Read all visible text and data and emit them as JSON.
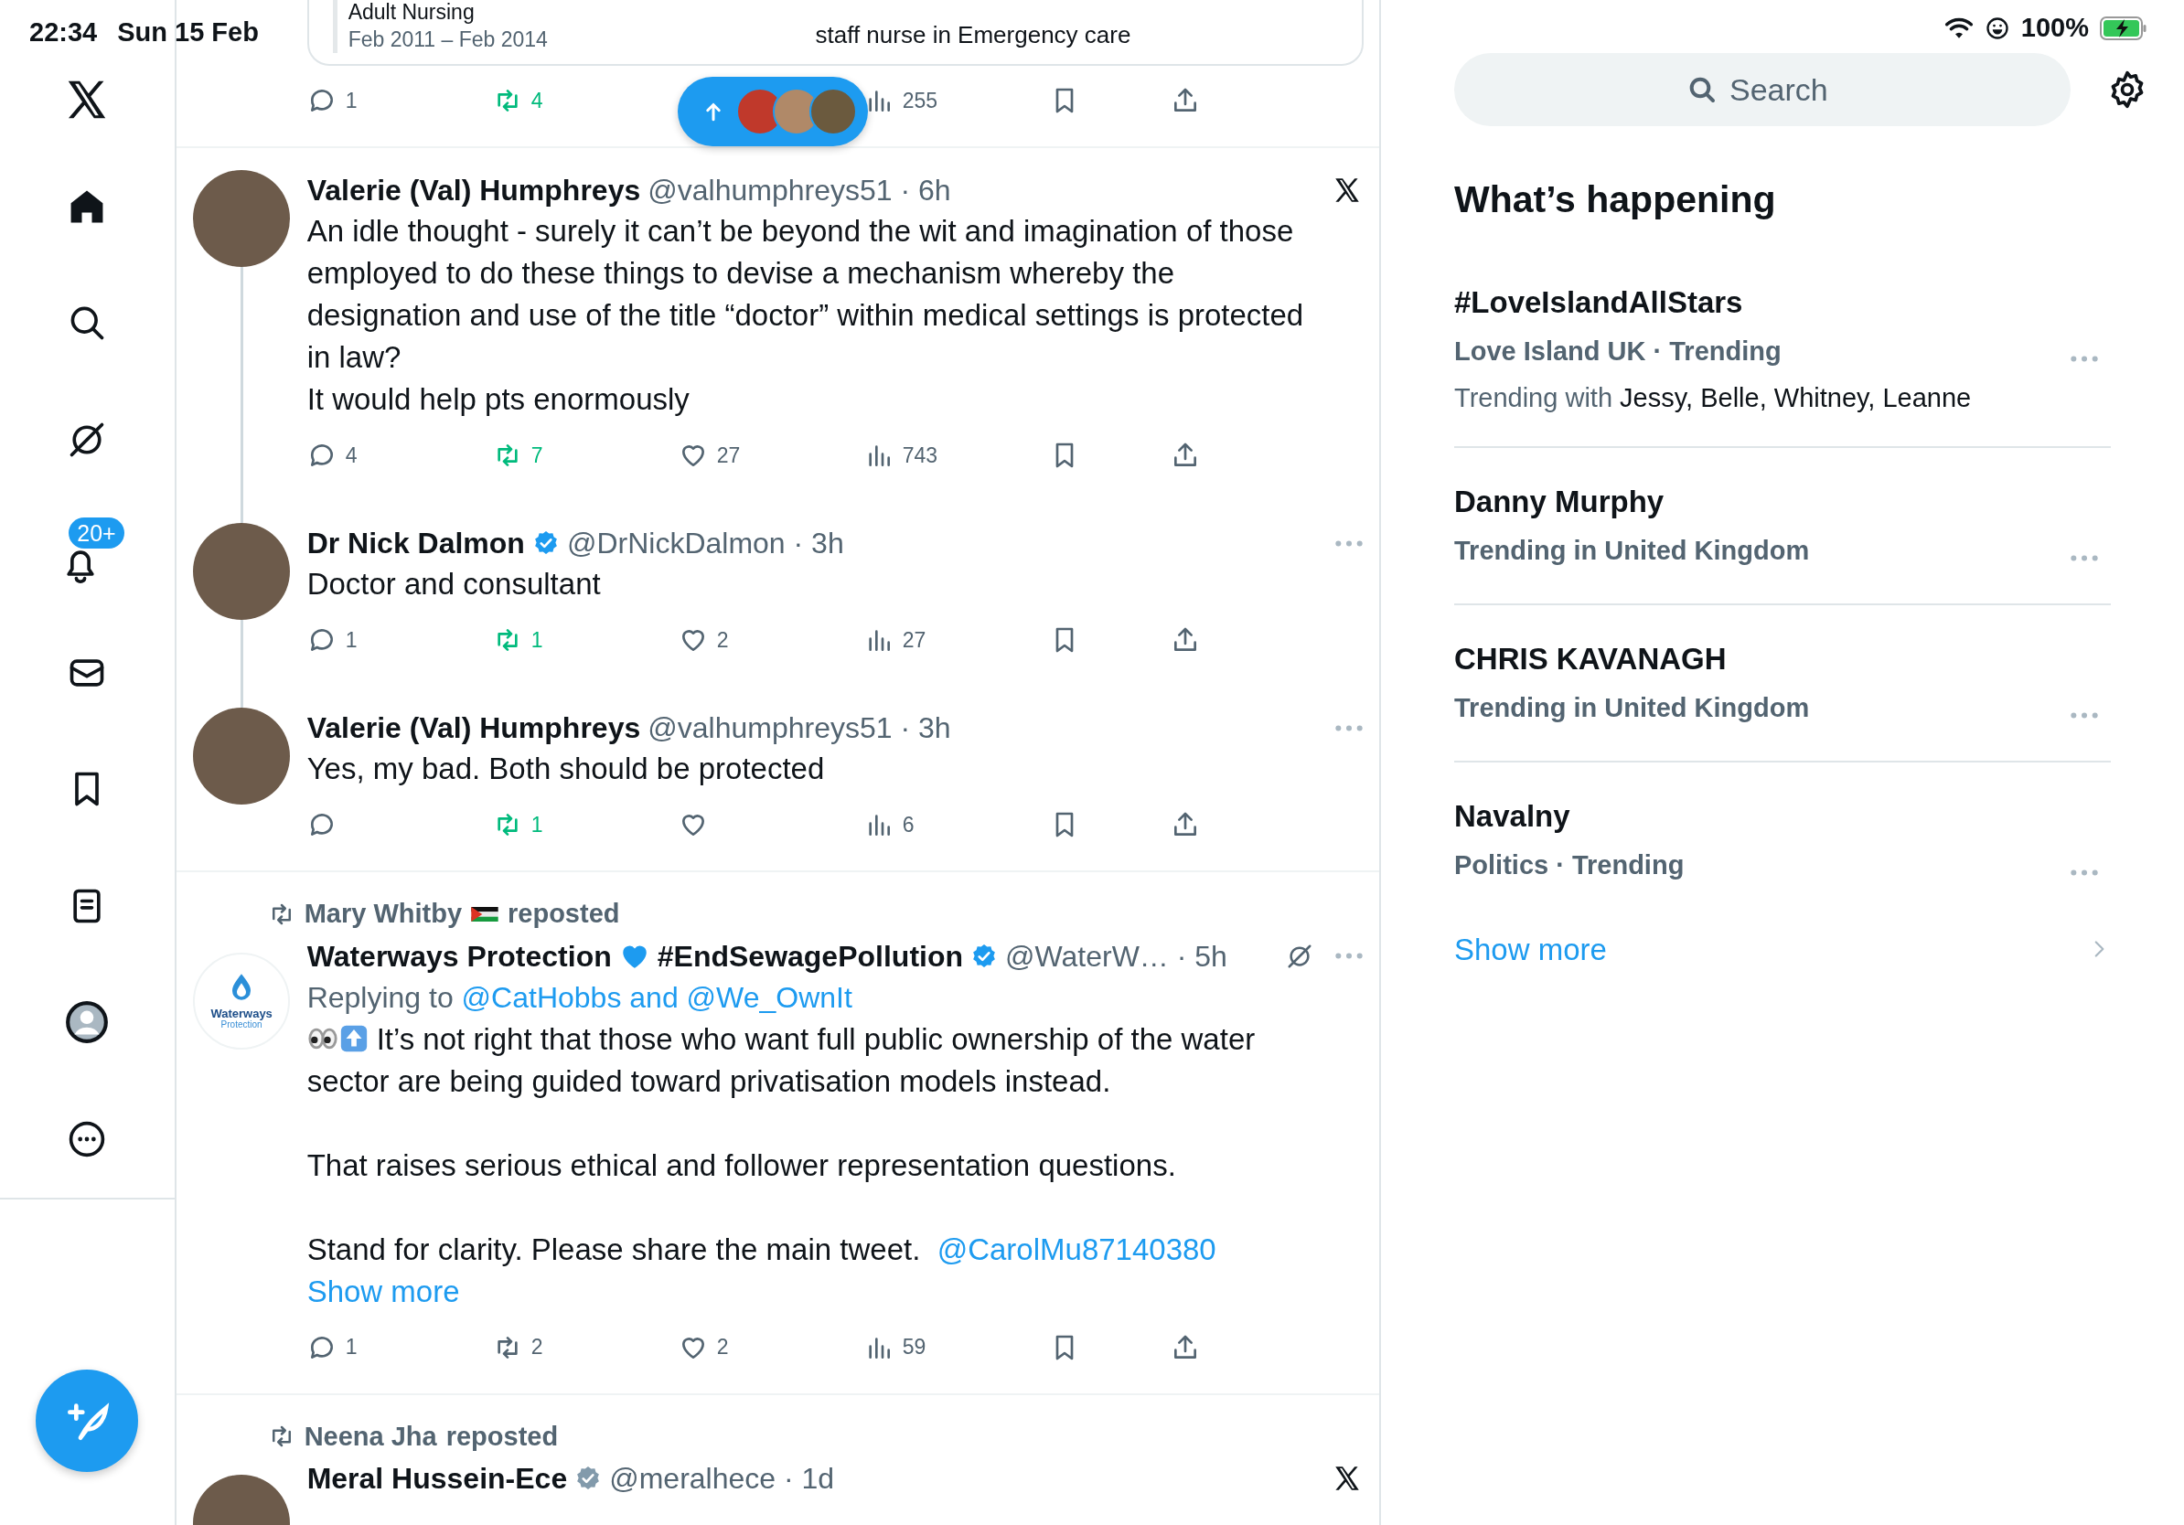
{
  "status_bar": {
    "time": "22:34",
    "date": "Sun 15 Feb",
    "battery": "100%"
  },
  "sidebar": {
    "items": [
      {
        "kind": "home",
        "selected": true
      },
      {
        "kind": "search",
        "selected": false
      },
      {
        "kind": "grok",
        "selected": false
      },
      {
        "kind": "notifications",
        "selected": false,
        "badge": "20+"
      },
      {
        "kind": "messages",
        "selected": false
      },
      {
        "kind": "bookmarks",
        "selected": false
      },
      {
        "kind": "lists",
        "selected": false
      },
      {
        "kind": "profile",
        "selected": false
      },
      {
        "kind": "more",
        "selected": false
      }
    ]
  },
  "feed": {
    "top_card": {
      "lines": [
        "Adult Nursing",
        "Feb 2011 – Feb 2014"
      ],
      "role": "staff nurse in Emergency care"
    },
    "top_actions": {
      "reply": "1",
      "repost": "4",
      "reposted": true,
      "views": "255"
    },
    "tweets": [
      {
        "name": "Valerie (Val) Humphreys",
        "meta": "@valhumphreys51 · 6h",
        "x_mark": true,
        "avatar_logo": false,
        "thread_down": true,
        "body": [
          {
            "text": "An idle thought - surely it can’t be beyond the wit and imagination of those employed to do these things to devise a mechanism whereby the designation and use of the title “doctor” within medical settings is protected in law?"
          },
          {
            "text": "It would help pts enormously"
          }
        ],
        "actions": {
          "reply": "4",
          "repost": "7",
          "reposted": true,
          "like": "27",
          "views": "743"
        }
      },
      {
        "name": "Dr Nick Dalmon",
        "verified": {
          "color": "#1d9bf0"
        },
        "meta": "@DrNickDalmon · 3h",
        "x_mark": false,
        "avatar_logo": false,
        "thread_up": true,
        "thread_down": true,
        "body": [
          {
            "text": "Doctor and consultant"
          }
        ],
        "actions": {
          "reply": "1",
          "repost": "1",
          "reposted": true,
          "like": "2",
          "views": "27"
        }
      },
      {
        "name": "Valerie (Val) Humphreys",
        "meta": "@valhumphreys51 · 3h",
        "x_mark": false,
        "avatar_logo": false,
        "thread_up": true,
        "body": [
          {
            "text": "Yes, my bad. Both should be protected"
          }
        ],
        "actions": {
          "repost": "1",
          "reposted": true,
          "views": "6"
        }
      },
      {
        "reposted_by": {
          "name": "Mary Whitby",
          "flag": true,
          "label": "reposted"
        },
        "name": "Waterways Protection",
        "name_heart": true,
        "name_tag": "#EndSewagePollution",
        "verified": {
          "color": "#1d9bf0"
        },
        "meta": "@WaterW… · 5h",
        "x_mark": false,
        "grok": true,
        "avatar_logo": true,
        "avatar_text": [
          "Waterways",
          "Protection"
        ],
        "paragraph_gap": true,
        "replying_to": {
          "label": "Replying to",
          "users": "@CatHobbs and @We_OwnIt"
        },
        "body": [
          {
            "icons": true,
            "text": "It’s not right that those who want full public ownership of the water sector are being guided toward privatisation models instead."
          },
          {
            "text": "That raises serious ethical and follower representation questions."
          },
          {
            "text": "Stand for clarity. Please share the main tweet.",
            "mention": "@CarolMu87140380",
            "show_more": "Show more"
          }
        ],
        "actions": {
          "reply": "1",
          "repost": "2",
          "reposted": false,
          "like": "2",
          "views": "59"
        }
      },
      {
        "reposted_by": {
          "name": "Neena Jha",
          "label": "reposted"
        },
        "name": "Meral Hussein-Ece",
        "verified": {
          "color": "#829aab"
        },
        "meta": "@meralhece · 1d",
        "x_mark": true,
        "avatar_logo": false
      }
    ]
  },
  "right_panel": {
    "search": {
      "placeholder": "Search"
    },
    "heading": "What’s happening",
    "trends": [
      {
        "title": "#LoveIslandAllStars",
        "meta": "Love Island UK · Trending",
        "with_label": "Trending with",
        "with_names": "Jessy, Belle, Whitney, Leanne"
      },
      {
        "title": "Danny Murphy",
        "meta": "Trending in United Kingdom"
      },
      {
        "title": "CHRIS KAVANAGH",
        "meta": "Trending in United Kingdom"
      },
      {
        "title": "Navalny",
        "meta": "Politics · Trending"
      }
    ],
    "show_more": "Show more"
  }
}
